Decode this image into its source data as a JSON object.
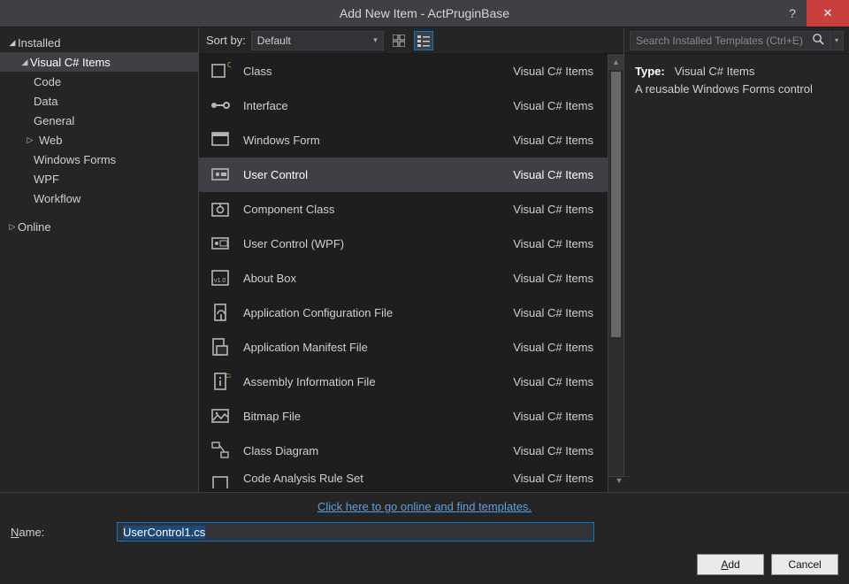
{
  "window": {
    "title": "Add New Item - ActPruginBase"
  },
  "tree": {
    "installed_label": "Installed",
    "csharp_items_label": "Visual C# Items",
    "children": [
      {
        "label": "Code"
      },
      {
        "label": "Data"
      },
      {
        "label": "General"
      },
      {
        "label": "Web",
        "expandable": true
      },
      {
        "label": "Windows Forms"
      },
      {
        "label": "WPF"
      },
      {
        "label": "Workflow"
      }
    ],
    "online_label": "Online"
  },
  "toolbar": {
    "sort_label": "Sort by:",
    "sort_value": "Default"
  },
  "templates": {
    "lang_label": "Visual C# Items",
    "items": [
      {
        "icon": "class-icon",
        "label": "Class"
      },
      {
        "icon": "interface-icon",
        "label": "Interface"
      },
      {
        "icon": "winform-icon",
        "label": "Windows Form"
      },
      {
        "icon": "usercontrol-icon",
        "label": "User Control",
        "selected": true
      },
      {
        "icon": "component-icon",
        "label": "Component Class"
      },
      {
        "icon": "usercontrol-wpf-icon",
        "label": "User Control (WPF)"
      },
      {
        "icon": "aboutbox-icon",
        "label": "About Box"
      },
      {
        "icon": "appconfig-icon",
        "label": "Application Configuration File"
      },
      {
        "icon": "manifest-icon",
        "label": "Application Manifest File"
      },
      {
        "icon": "assemblyinfo-icon",
        "label": "Assembly Information File"
      },
      {
        "icon": "bitmap-icon",
        "label": "Bitmap File"
      },
      {
        "icon": "classdiagram-icon",
        "label": "Class Diagram"
      },
      {
        "icon": "partial-icon",
        "label": "Code Analysis Rule Set",
        "partial": true
      }
    ]
  },
  "search": {
    "placeholder": "Search Installed Templates (Ctrl+E)"
  },
  "info": {
    "type_label": "Type:",
    "type_value": "Visual C# Items",
    "description": "A reusable Windows Forms control"
  },
  "online_link": "Click here to go online and find templates.",
  "name_row": {
    "label_underline": "N",
    "label_rest": "ame:",
    "value": "UserControl1.cs"
  },
  "buttons": {
    "add_underline": "A",
    "add_rest": "dd",
    "cancel": "Cancel"
  }
}
